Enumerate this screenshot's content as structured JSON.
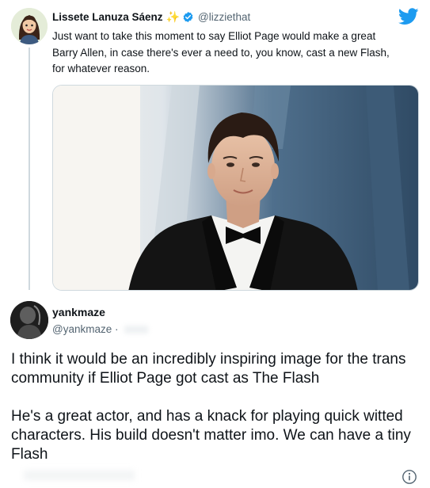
{
  "parent_tweet": {
    "author_name": "Lissete Lanuza Sáenz",
    "name_emoji": "✨",
    "handle": "@lizziethat",
    "text": "Just want to take this moment to say Elliot Page would make a great\nBarry Allen, in case there's ever a need to, you know, cast a new Flash,\nfor whatever reason.",
    "icons": [
      "sparkle-emoji",
      "verified-badge-icon",
      "twitter-bird-icon"
    ]
  },
  "reply_tweet": {
    "author_name": "yankmaze",
    "handle": "@yankmaze",
    "separator": "·",
    "paragraphs": [
      "I think it would be an incredibly inspiring image for the trans community if Elliot Page got cast as The Flash",
      "He's a great actor, and has a knack for playing quick witted characters. His build doesn't matter imo. We can have a tiny Flash"
    ],
    "icons": [
      "info-icon"
    ]
  },
  "colors": {
    "twitter_blue": "#1d9bf0",
    "secondary_text": "#536471",
    "primary_text": "#0f1419",
    "thread_line": "#cfd9de"
  }
}
